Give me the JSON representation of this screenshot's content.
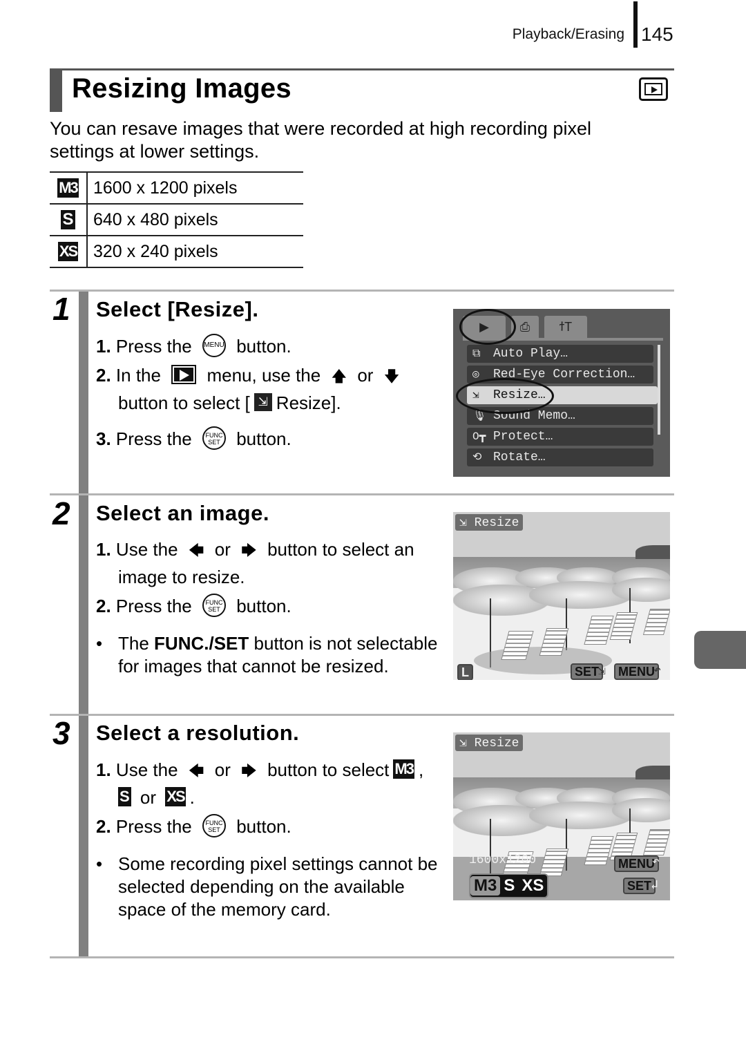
{
  "header": {
    "section": "Playback/Erasing",
    "page_number": "145"
  },
  "title": "Resizing Images",
  "title_icon": "playback-mode-icon",
  "intro": "You can resave images that were recorded at high recording pixel settings at lower settings.",
  "resolutions": [
    {
      "badge": "M3",
      "text": "1600 x 1200 pixels"
    },
    {
      "badge": "S",
      "text": "640 x 480 pixels"
    },
    {
      "badge": "XS",
      "text": "320 x 240 pixels"
    }
  ],
  "steps": [
    {
      "number": "1",
      "title": "Select [Resize].",
      "instructions": {
        "i1_num": "1.",
        "i1_pre": "Press the",
        "i1_btn": "MENU",
        "i1_post": "button.",
        "i2_num": "2.",
        "i2_pre": "In the",
        "i2_mid": "menu, use the",
        "i2_up": "🡅",
        "i2_or": "or",
        "i2_down": "🡇",
        "i2_cont_pre": "button to select [",
        "i2_cont_post": "Resize].",
        "i3_num": "3.",
        "i3_pre": "Press the",
        "i3_btn_l1": "FUNC",
        "i3_btn_l2": "SET",
        "i3_post": "button."
      },
      "screen": {
        "tabs": [
          "▶",
          "⎙",
          "ϯT"
        ],
        "items": [
          {
            "icon": "⧉",
            "label": "Auto Play…"
          },
          {
            "icon": "◎",
            "label": "Red-Eye Correction…"
          },
          {
            "icon": "⇲",
            "label": "Resize…",
            "selected": true
          },
          {
            "icon": "🎙",
            "label": "Sound Memo…"
          },
          {
            "icon": "O┳",
            "label": "Protect…"
          },
          {
            "icon": "⟲",
            "label": "Rotate…"
          }
        ]
      }
    },
    {
      "number": "2",
      "title": "Select an image.",
      "instructions": {
        "i1_num": "1.",
        "i1_pre": "Use the",
        "i1_left": "🡄",
        "i1_or": "or",
        "i1_right": "🡆",
        "i1_post": "button to select an",
        "i1_cont": "image to resize.",
        "i2_num": "2.",
        "i2_pre": "Press the",
        "i2_btn_l1": "FUNC",
        "i2_btn_l2": "SET",
        "i2_post": "button."
      },
      "bullet": {
        "pre": "The ",
        "bold": "FUNC./SET",
        "post": " button is not selectable for images that cannot be resized."
      },
      "screen": {
        "label": "Resize",
        "size_badge": "L",
        "set_btn": "SET",
        "menu_btn": "MENU",
        "back_glyph": "↶"
      }
    },
    {
      "number": "3",
      "title": "Select a resolution.",
      "instructions": {
        "i1_num": "1.",
        "i1_pre": "Use the",
        "i1_left": "🡄",
        "i1_or": "or",
        "i1_right": "🡆",
        "i1_post": "button to select",
        "i1_badge1": "M3",
        "i1_comma": ",",
        "i1_badge2": "S",
        "i1_or2": "or",
        "i1_badge3": "XS",
        "i1_period": ".",
        "i2_num": "2.",
        "i2_pre": "Press the",
        "i2_btn_l1": "FUNC",
        "i2_btn_l2": "SET",
        "i2_post": "button."
      },
      "bullet": {
        "text": "Some recording pixel settings cannot be selected depending on the available space of the memory card."
      },
      "screen": {
        "label": "Resize",
        "resolution_text": "1600x1200",
        "menu_btn": "MENU",
        "set_btn": "SET",
        "back_glyph": "↶",
        "options": [
          "M3",
          "S",
          "XS"
        ],
        "selected_option": "M3"
      }
    }
  ]
}
